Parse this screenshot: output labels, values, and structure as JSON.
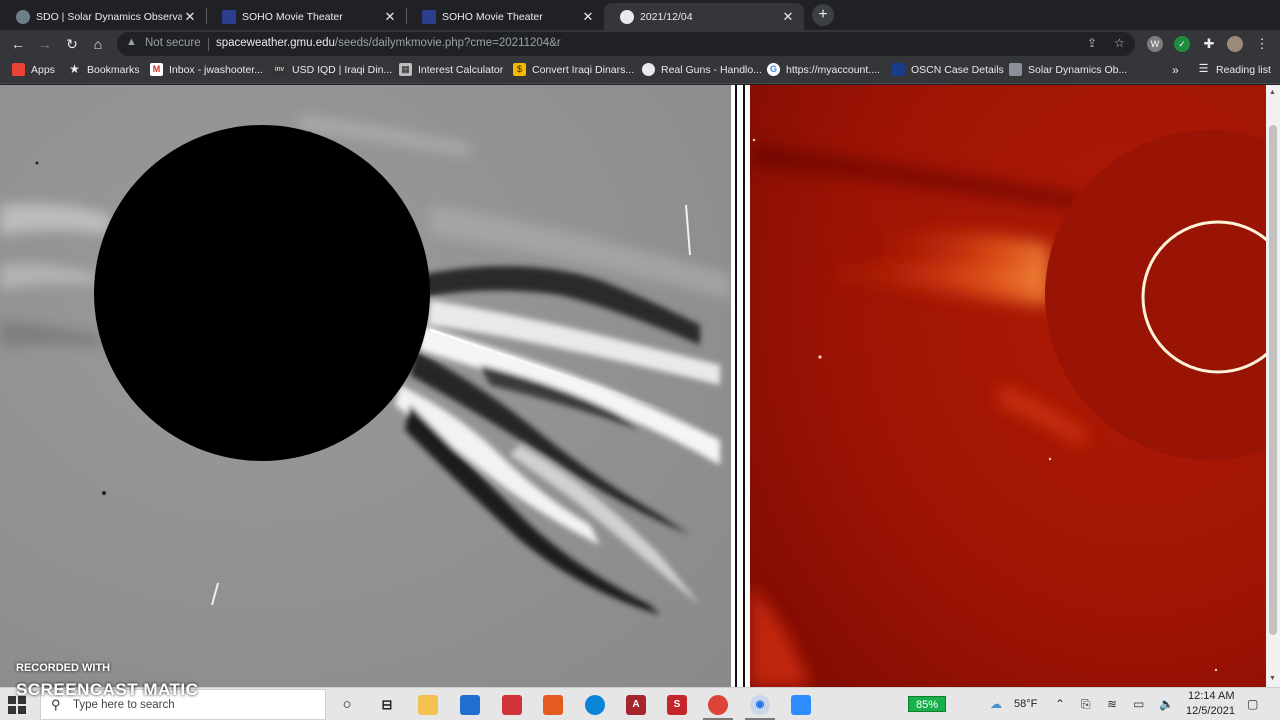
{
  "browser": {
    "tabs": [
      {
        "title": "SDO | Solar Dynamics Observatory",
        "favicon_color": "#6f7f8a",
        "active": false
      },
      {
        "title": "SOHO Movie Theater",
        "favicon_color": "#2c3f8f",
        "active": false
      },
      {
        "title": "SOHO Movie Theater",
        "favicon_color": "#2c3f8f",
        "active": false
      },
      {
        "title": "2021/12/04",
        "favicon_color": "#e8eaed",
        "active": true
      }
    ],
    "new_tab_label": "+",
    "address": {
      "security": "Not secure",
      "host": "spaceweather.gmu.edu",
      "path": "/seeds/dailymkmovie.php?cme=20211204&r"
    },
    "bookmarks": [
      {
        "label": "Apps",
        "icon": "apps-grid-icon"
      },
      {
        "label": "Bookmarks",
        "icon": "star-icon"
      },
      {
        "label": "Inbox - jwashooter...",
        "icon": "gmail-icon"
      },
      {
        "label": "USD IQD | Iraqi Din...",
        "icon": "inv-icon"
      },
      {
        "label": "Interest Calculator",
        "icon": "calculator-icon"
      },
      {
        "label": "Convert Iraqi Dinars...",
        "icon": "exchange-icon"
      },
      {
        "label": "Real Guns - Handlo...",
        "icon": "globe-icon"
      },
      {
        "label": "https://myaccount....",
        "icon": "google-icon"
      },
      {
        "label": "OSCN Case Details",
        "icon": "oscn-icon"
      },
      {
        "label": "Solar Dynamics Ob...",
        "icon": "sdo-icon"
      }
    ],
    "bookmarks_overflow": "»",
    "reading_list": "Reading list"
  },
  "watermark": {
    "recorded_with": "RECORDED WITH",
    "brand": "SCREENCAST  MATIC"
  },
  "taskbar": {
    "search_placeholder": "Type here to search",
    "battery": "85%",
    "weather": "58°F",
    "time": "12:14 AM",
    "date": "12/5/2021"
  },
  "colors": {
    "chrome_dark": "#202124",
    "chrome_toolbar": "#35363a",
    "c2_red": "#b01a06",
    "taskbar": "#e6e6e6"
  }
}
